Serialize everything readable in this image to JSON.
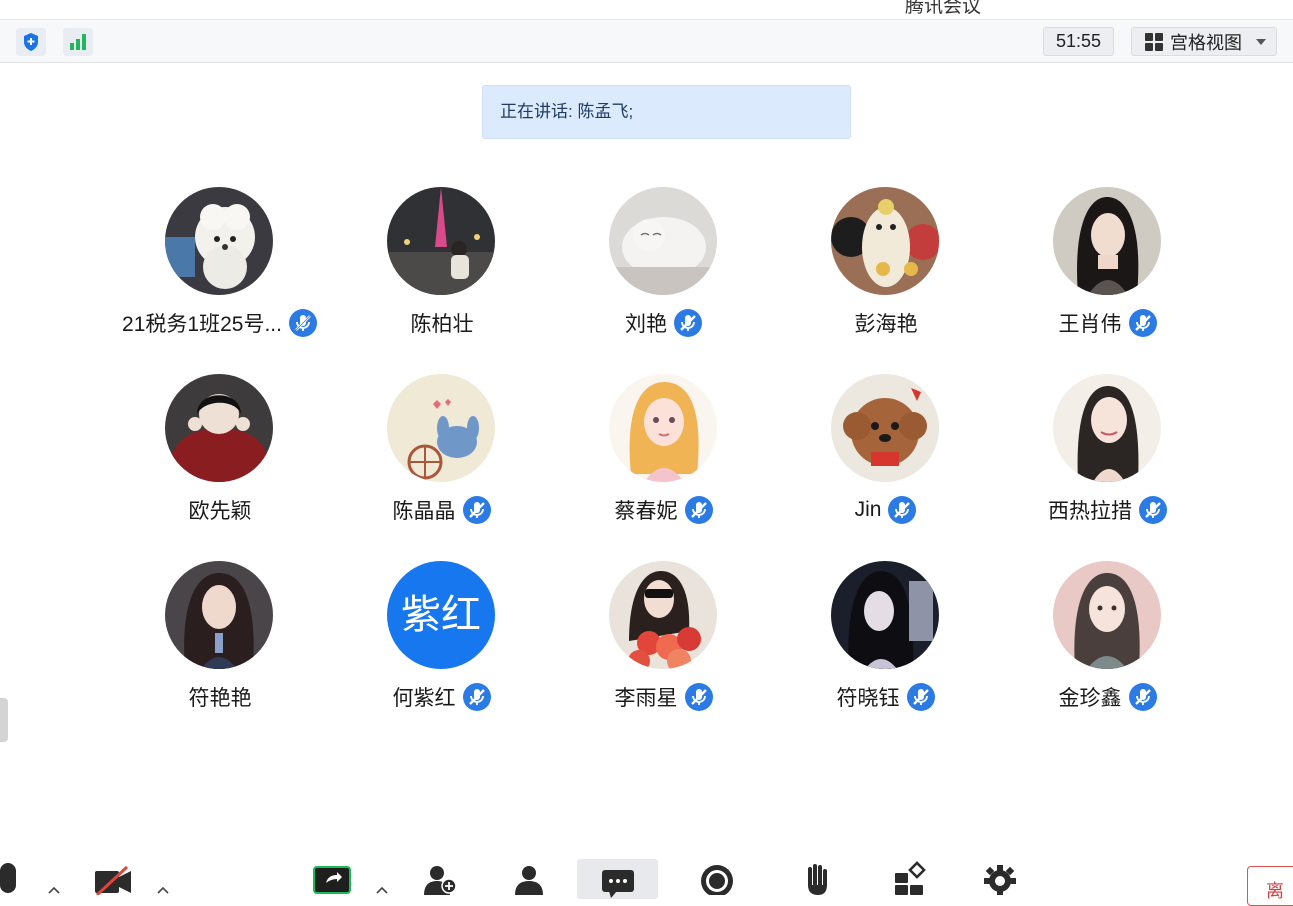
{
  "window": {
    "app_title": "腾讯会议"
  },
  "topbar": {
    "icons": [
      "shield-icon",
      "signal-strength-icon"
    ],
    "timer": "51:55",
    "view_mode_label": "宫格视图"
  },
  "speaking": {
    "text": "正在讲话: 陈孟飞;"
  },
  "colors": {
    "accent": "#1677ee",
    "banner_bg": "#dceafd",
    "mute_badge": "#2c7be5",
    "leave_red": "#d23c3c"
  },
  "participants": [
    {
      "name": "21税务1班25号...",
      "muted": true
    },
    {
      "name": "陈柏壮",
      "muted": false
    },
    {
      "name": "刘艳",
      "muted": true
    },
    {
      "name": "彭海艳",
      "muted": false
    },
    {
      "name": "王肖伟",
      "muted": true
    },
    {
      "name": "欧先颖",
      "muted": false
    },
    {
      "name": "陈晶晶",
      "muted": true
    },
    {
      "name": "蔡春妮",
      "muted": true
    },
    {
      "name": "Jin",
      "muted": true
    },
    {
      "name": "西热拉措",
      "muted": true
    },
    {
      "name": "符艳艳",
      "muted": false
    },
    {
      "name": "何紫红",
      "muted": true,
      "avatar_text": "紫红"
    },
    {
      "name": "李雨星",
      "muted": true
    },
    {
      "name": "符晓钰",
      "muted": true
    },
    {
      "name": "金珍鑫",
      "muted": true
    }
  ],
  "toolbar": {
    "icons": [
      "microphone-icon",
      "camera-off-icon",
      "share-screen-icon",
      "invite-member-icon",
      "participants-icon",
      "chat-icon",
      "record-icon",
      "raise-hand-icon",
      "apps-icon",
      "settings-icon"
    ],
    "leave_label": "离"
  }
}
